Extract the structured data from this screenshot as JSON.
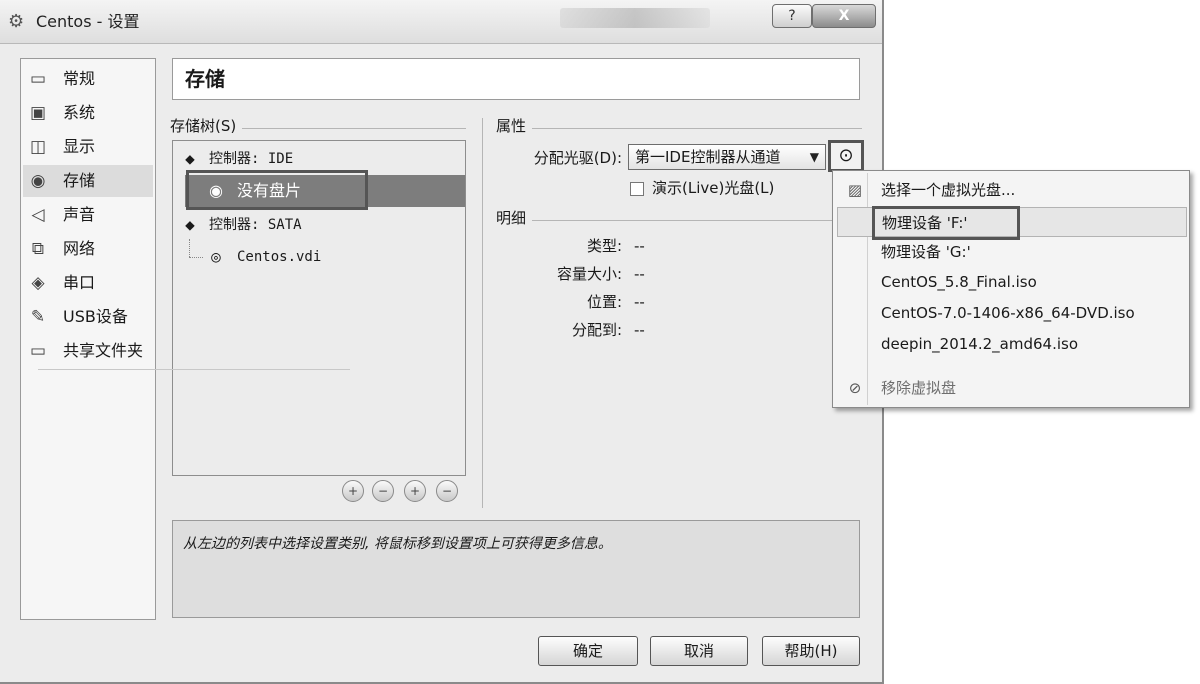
{
  "window": {
    "title": "Centos - 设置",
    "icon": "gear-icon",
    "help_label": "?",
    "close_label": "X"
  },
  "sidebar": {
    "items": [
      {
        "label": "常规",
        "icon": "monitor-icon"
      },
      {
        "label": "系统",
        "icon": "chip-icon"
      },
      {
        "label": "显示",
        "icon": "display-icon"
      },
      {
        "label": "存储",
        "icon": "disc-icon",
        "selected": true
      },
      {
        "label": "声音",
        "icon": "speaker-icon"
      },
      {
        "label": "网络",
        "icon": "network-icon"
      },
      {
        "label": "串口",
        "icon": "serial-port-icon"
      },
      {
        "label": "USB设备",
        "icon": "usb-icon"
      },
      {
        "label": "共享文件夹",
        "icon": "folder-icon"
      }
    ]
  },
  "page_title": "存储",
  "storage_tree": {
    "label": "存储树(S)",
    "rows": [
      {
        "text": "控制器: IDE",
        "icon": "controller-icon"
      },
      {
        "text": "没有盘片",
        "icon": "cd-icon",
        "selected": true
      },
      {
        "text": "控制器: SATA",
        "icon": "controller-icon"
      },
      {
        "text": "Centos.vdi",
        "icon": "hard-disk-icon"
      }
    ],
    "tools": [
      "add-attachment-icon",
      "remove-attachment-icon",
      "add-controller-icon",
      "remove-controller-icon"
    ]
  },
  "attributes": {
    "label": "属性",
    "drive_label": "分配光驱(D):",
    "drive_value": "第一IDE控制器从通道",
    "live_cd_label": "演示(Live)光盘(L)",
    "live_cd_checked": false
  },
  "details": {
    "label": "明细",
    "rows": [
      {
        "label": "类型:",
        "value": "--"
      },
      {
        "label": "容量大小:",
        "value": "--"
      },
      {
        "label": "位置:",
        "value": "--"
      },
      {
        "label": "分配到:",
        "value": "--"
      }
    ]
  },
  "info_text": "从左边的列表中选择设置类别, 将鼠标移到设置项上可获得更多信息。",
  "buttons": {
    "ok": "确定",
    "cancel": "取消",
    "help": "帮助(H)"
  },
  "disc_menu": {
    "items": [
      {
        "label": "选择一个虚拟光盘...",
        "icon": "folder-open-icon"
      },
      {
        "label": "物理设备 'F:'",
        "selected": true
      },
      {
        "label": "物理设备 'G:'"
      },
      {
        "label": "CentOS_5.8_Final.iso"
      },
      {
        "label": "CentOS-7.0-1406-x86_64-DVD.iso"
      },
      {
        "label": "deepin_2014.2_amd64.iso"
      }
    ],
    "remove_label": "移除虚拟盘",
    "remove_icon": "eject-icon"
  }
}
